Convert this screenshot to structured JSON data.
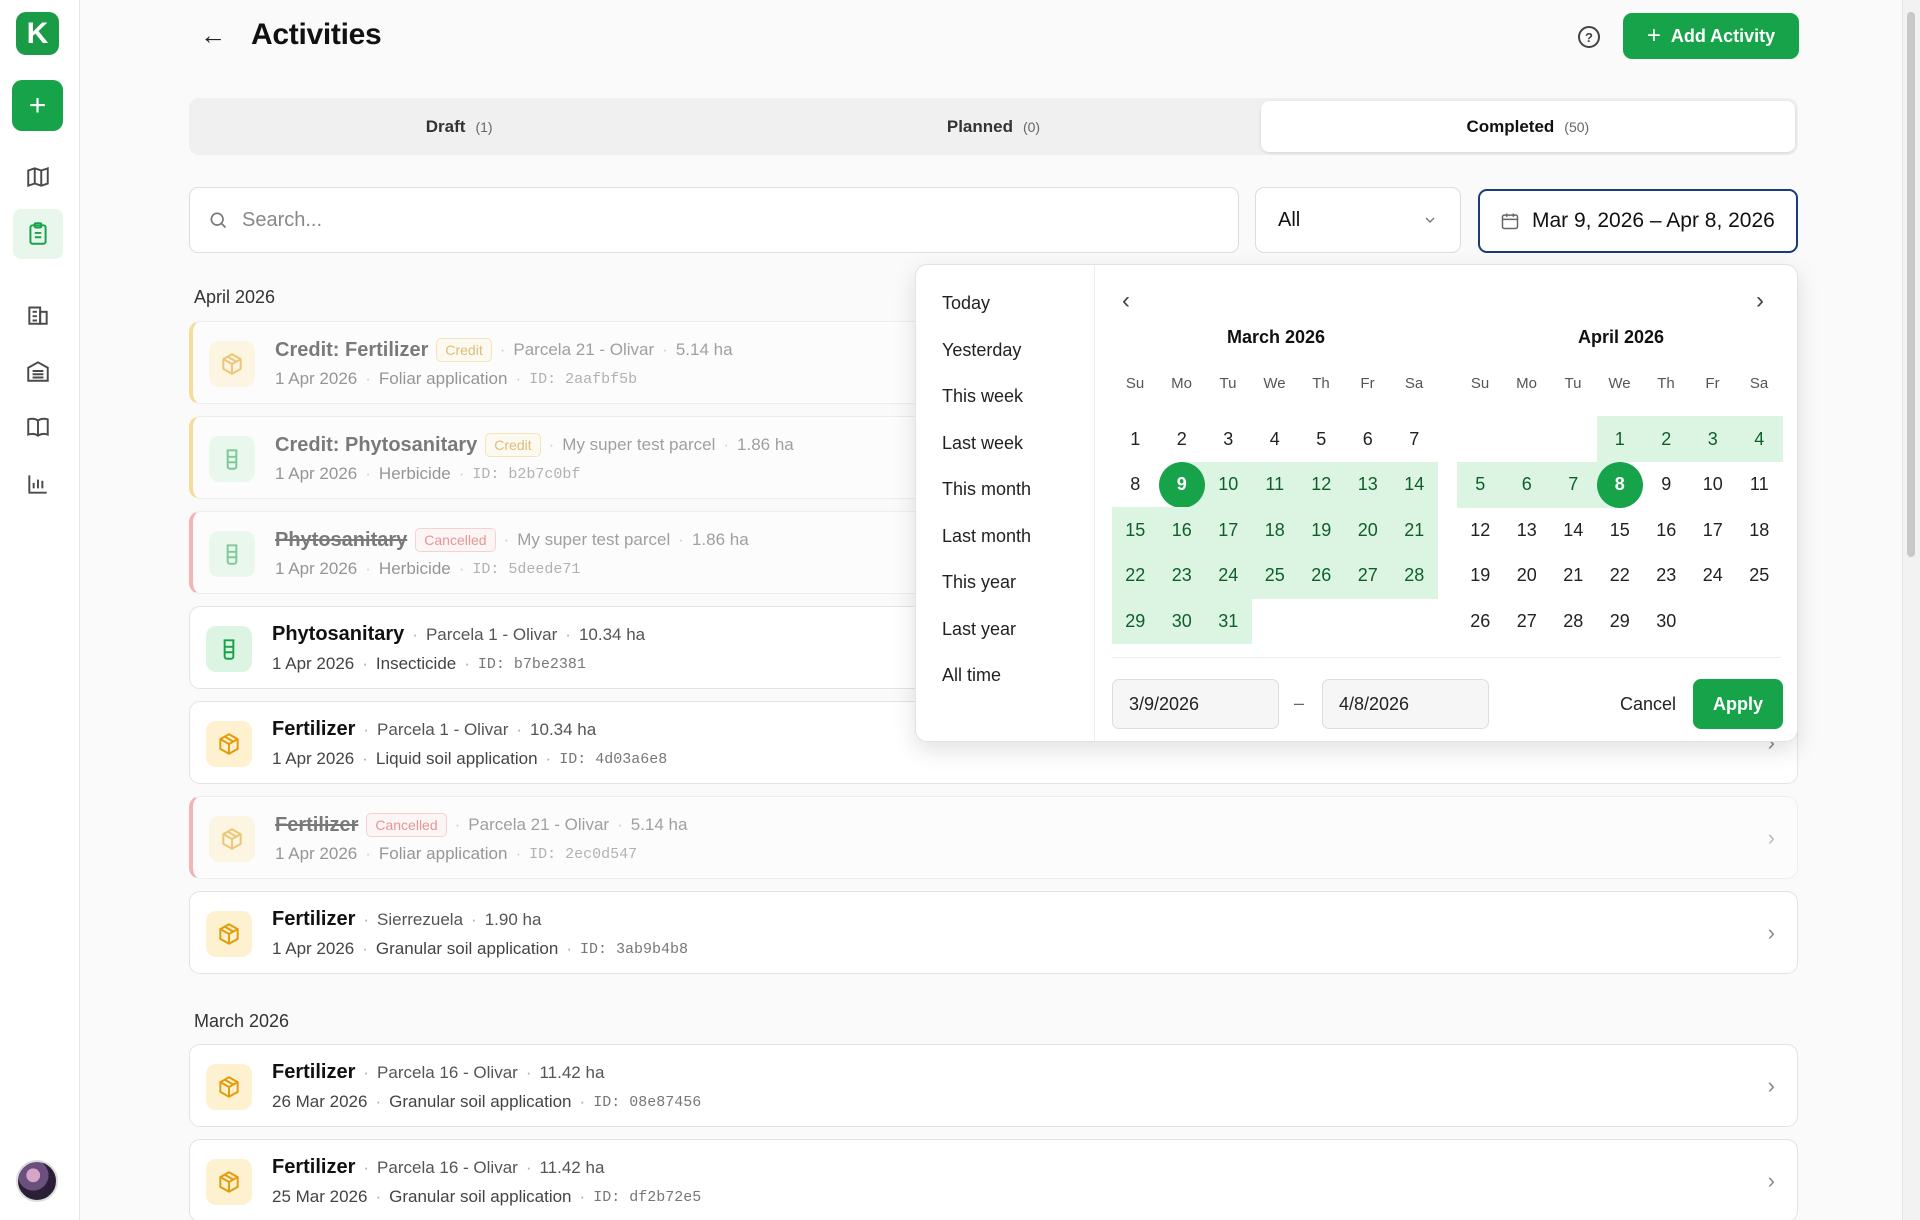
{
  "app": {
    "logo_letter": "K",
    "page_title": "Activities",
    "add_button": "Add Activity",
    "help": "?"
  },
  "tabs": [
    {
      "label": "Draft",
      "count": "(1)"
    },
    {
      "label": "Planned",
      "count": "(0)"
    },
    {
      "label": "Completed",
      "count": "(50)",
      "active": true
    }
  ],
  "filters": {
    "search_placeholder": "Search...",
    "select_value": "All",
    "date_range": "Mar 9, 2026 – Apr 8, 2026"
  },
  "sections": {
    "april": "April 2026",
    "march": "March 2026"
  },
  "activities": [
    {
      "name": "Credit: Fertilizer",
      "badge": "Credit",
      "parcel": "Parcela 21 - Olivar",
      "area": "5.14 ha",
      "date": "1 Apr 2026",
      "method": "Foliar application",
      "id": "ID: 2aafbf5b"
    },
    {
      "name": "Credit: Phytosanitary",
      "badge": "Credit",
      "parcel": "My super test parcel",
      "area": "1.86 ha",
      "date": "1 Apr 2026",
      "method": "Herbicide",
      "id": "ID: b2b7c0bf"
    },
    {
      "name": "Phytosanitary",
      "badge": "Cancelled",
      "parcel": "My super test parcel",
      "area": "1.86 ha",
      "date": "1 Apr 2026",
      "method": "Herbicide",
      "id": "ID: 5deede71"
    },
    {
      "name": "Phytosanitary",
      "parcel": "Parcela 1 - Olivar",
      "area": "10.34 ha",
      "date": "1 Apr 2026",
      "method": "Insecticide",
      "id": "ID: b7be2381"
    },
    {
      "name": "Fertilizer",
      "parcel": "Parcela 1 - Olivar",
      "area": "10.34 ha",
      "date": "1 Apr 2026",
      "method": "Liquid soil application",
      "id": "ID: 4d03a6e8"
    },
    {
      "name": "Fertilizer",
      "badge": "Cancelled",
      "parcel": "Parcela 21 - Olivar",
      "area": "5.14 ha",
      "date": "1 Apr 2026",
      "method": "Foliar application",
      "id": "ID: 2ec0d547"
    },
    {
      "name": "Fertilizer",
      "parcel": "Sierrezuela",
      "area": "1.90 ha",
      "date": "1 Apr 2026",
      "method": "Granular soil application",
      "id": "ID: 3ab9b4b8"
    },
    {
      "name": "Fertilizer",
      "parcel": "Parcela 16 - Olivar",
      "area": "11.42 ha",
      "date": "26 Mar 2026",
      "method": "Granular soil application",
      "id": "ID: 08e87456"
    },
    {
      "name": "Fertilizer",
      "parcel": "Parcela 16 - Olivar",
      "area": "11.42 ha",
      "date": "25 Mar 2026",
      "method": "Granular soil application",
      "id": "ID: df2b72e5"
    }
  ],
  "datepicker": {
    "presets": [
      "Today",
      "Yesterday",
      "This week",
      "Last week",
      "This month",
      "Last month",
      "This year",
      "Last year",
      "All time"
    ],
    "weekdays": [
      "Su",
      "Mo",
      "Tu",
      "We",
      "Th",
      "Fr",
      "Sa"
    ],
    "months": [
      {
        "title": "March 2026",
        "first_weekday": 0,
        "days": 31
      },
      {
        "title": "April 2026",
        "first_weekday": 3,
        "days": 30
      }
    ],
    "range_start": "3/9/2026",
    "range_end": "4/8/2026",
    "separator": "–",
    "cancel": "Cancel",
    "apply": "Apply"
  },
  "colors": {
    "accent": "#16a34a",
    "range_fill": "#dcf5e3",
    "credit": "#c98a10",
    "cancelled": "#d84343"
  }
}
